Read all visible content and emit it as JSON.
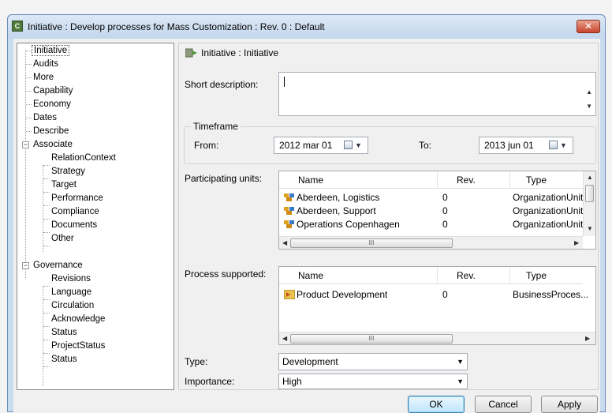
{
  "window": {
    "title": "Initiative : Develop processes for Mass Customization : Rev. 0  : Default",
    "icon_letter": "C",
    "close_glyph": "✕"
  },
  "tree": {
    "items": [
      {
        "label": "Initiative"
      },
      {
        "label": "Audits"
      },
      {
        "label": "More"
      },
      {
        "label": "Capability"
      },
      {
        "label": "Economy"
      },
      {
        "label": "Dates"
      },
      {
        "label": "Describe"
      },
      {
        "label": "Associate"
      },
      {
        "label": "RelationContext"
      },
      {
        "label": "Strategy"
      },
      {
        "label": "Target"
      },
      {
        "label": "Performance"
      },
      {
        "label": "Compliance"
      },
      {
        "label": "Documents"
      },
      {
        "label": "Other"
      },
      {
        "label": "Governance"
      },
      {
        "label": "Revisions"
      },
      {
        "label": "Language"
      },
      {
        "label": "Circulation"
      },
      {
        "label": "Acknowledge"
      },
      {
        "label": "Status"
      },
      {
        "label": "ProjectStatus"
      },
      {
        "label": "Status"
      }
    ],
    "expander_glyph": "−"
  },
  "panel": {
    "breadcrumb": "Initiative : Initiative",
    "short_description_label": "Short description:",
    "short_description_value": "",
    "timeframe_legend": "Timeframe",
    "from_label": "From:",
    "from_value": "2012 mar 01",
    "to_label": "To:",
    "to_value": "2013 jun 01",
    "participating_label": "Participating units:",
    "process_label": "Process supported:",
    "type_label": "Type:",
    "type_value": "Development",
    "importance_label": "Importance:",
    "importance_value": "High"
  },
  "participating_units": {
    "columns": [
      "Name",
      "Rev.",
      "Type"
    ],
    "rows": [
      {
        "name": "Aberdeen, Logistics",
        "rev": "0",
        "type": "OrganizationUnit"
      },
      {
        "name": "Aberdeen, Support",
        "rev": "0",
        "type": "OrganizationUnit"
      },
      {
        "name": "Operations Copenhagen",
        "rev": "0",
        "type": "OrganizationUnit"
      }
    ]
  },
  "process_supported": {
    "columns": [
      "Name",
      "Rev.",
      "Type"
    ],
    "rows": [
      {
        "name": "Product Development",
        "rev": "0",
        "type": "BusinessProces..."
      }
    ]
  },
  "buttons": {
    "ok": "OK",
    "cancel": "Cancel",
    "apply": "Apply"
  },
  "glyphs": {
    "combo_arrow": "▼",
    "scroll_up": "▲",
    "scroll_down": "▼",
    "scroll_left": "◀",
    "scroll_right": "▶",
    "thumb_grip": "III"
  },
  "colors": {
    "title_gradient_top": "#dce9f7",
    "close_red": "#c8452c",
    "default_button": "#bee6fd"
  }
}
